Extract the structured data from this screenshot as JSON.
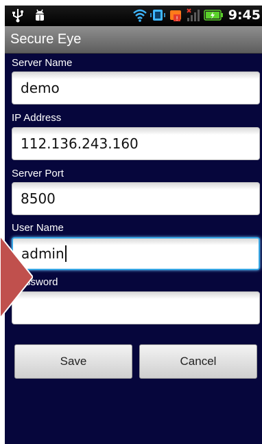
{
  "status_bar": {
    "time": "9:45",
    "icons": [
      "usb-icon",
      "android-debug-icon",
      "wifi-icon",
      "sync-icon",
      "notification-icon",
      "signal-icon",
      "battery-charging-icon"
    ]
  },
  "app": {
    "title": "Secure Eye"
  },
  "form": {
    "server_name": {
      "label": "Server Name",
      "value": "demo"
    },
    "ip_address": {
      "label": "IP Address",
      "value": "112.136.243.160"
    },
    "server_port": {
      "label": "Server Port",
      "value": "8500"
    },
    "user_name": {
      "label": "User Name",
      "value": "admin"
    },
    "password": {
      "label": "ssword",
      "value": ""
    }
  },
  "buttons": {
    "save": "Save",
    "cancel": "Cancel"
  },
  "colors": {
    "background": "#06063c",
    "focus": "#36a6e4",
    "arrow": "#c0504d"
  }
}
